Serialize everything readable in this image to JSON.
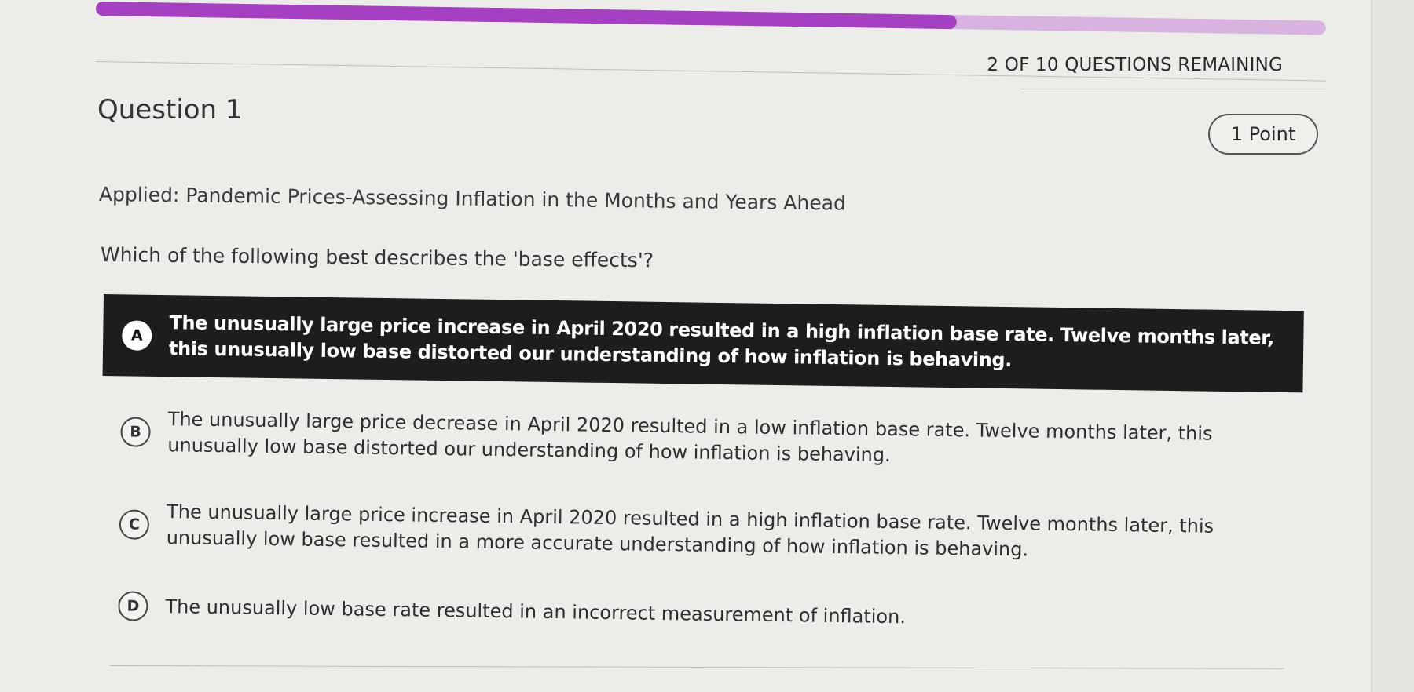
{
  "progress": {
    "fraction": 0.7,
    "fill_color": "#a540c2",
    "track_color": "#d8b3e0"
  },
  "header": {
    "remaining": "2 OF 10 QUESTIONS REMAINING"
  },
  "question": {
    "title": "Question 1",
    "points": "1 Point",
    "subtitle": "Applied: Pandemic Prices-Assessing Inflation in the Months and Years Ahead",
    "prompt": "Which of the following best describes the 'base effects'?"
  },
  "options": [
    {
      "letter": "A",
      "text": "The unusually large price increase in April 2020 resulted in a high inflation base rate. Twelve months later, this unusually low base distorted our understanding of how inflation is behaving.",
      "selected": true
    },
    {
      "letter": "B",
      "text": "The unusually large price decrease in April 2020 resulted in a low inflation base rate. Twelve months later, this unusually low base distorted our understanding of how inflation is behaving.",
      "selected": false
    },
    {
      "letter": "C",
      "text": "The unusually large price increase in April 2020 resulted in a high inflation base rate. Twelve months later, this unusually low base resulted in a more accurate understanding of how inflation is behaving.",
      "selected": false
    },
    {
      "letter": "D",
      "text": "The unusually low base rate resulted in an incorrect measurement of inflation.",
      "selected": false
    }
  ]
}
